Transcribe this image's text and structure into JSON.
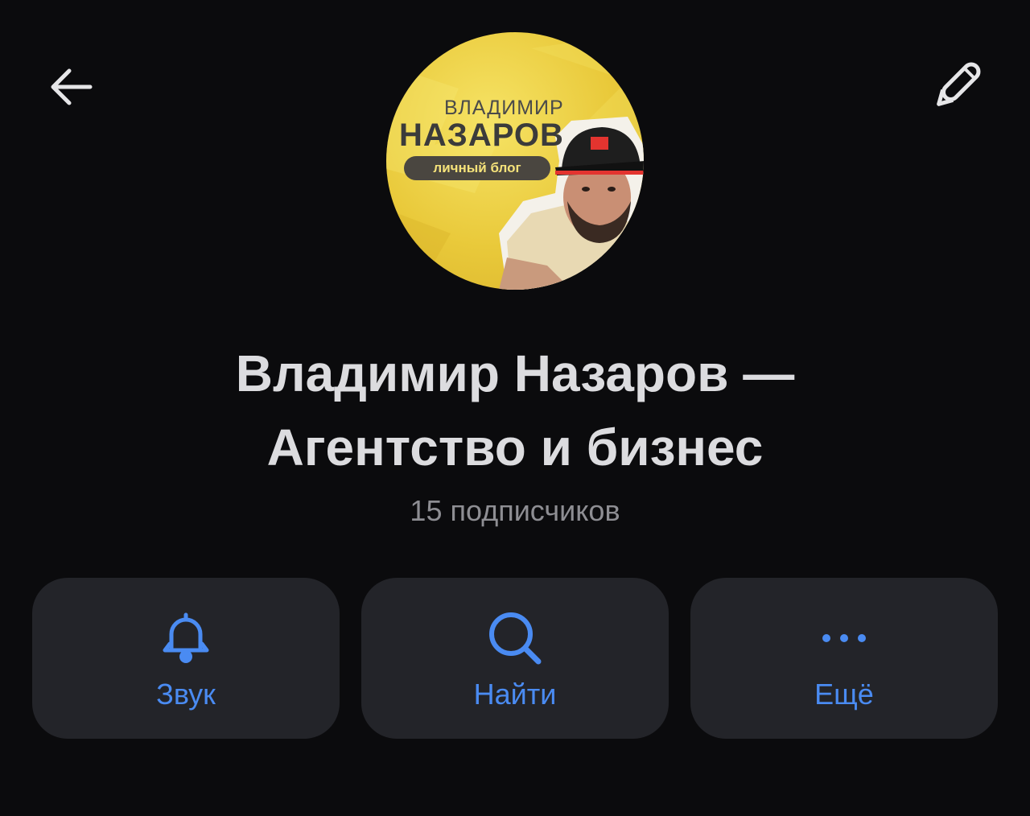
{
  "topbar": {
    "back_icon": "arrow-left-icon",
    "edit_icon": "pencil-icon"
  },
  "avatar": {
    "line1": "ВЛАДИМИР",
    "line2": "НАЗАРОВ",
    "line3": "личный блог"
  },
  "channel": {
    "title_line1": "Владимир Назаров —",
    "title_line2": "Агентство и бизнес",
    "subscribers": "15 подписчиков"
  },
  "actions": [
    {
      "label": "Звук",
      "icon": "bell-icon"
    },
    {
      "label": "Найти",
      "icon": "search-icon"
    },
    {
      "label": "Ещё",
      "icon": "more-dots-icon"
    }
  ],
  "colors": {
    "background": "#0b0b0d",
    "button_bg": "#232429",
    "accent": "#4a8bf2",
    "title": "#dcdcdf",
    "muted": "#8e8e93"
  }
}
